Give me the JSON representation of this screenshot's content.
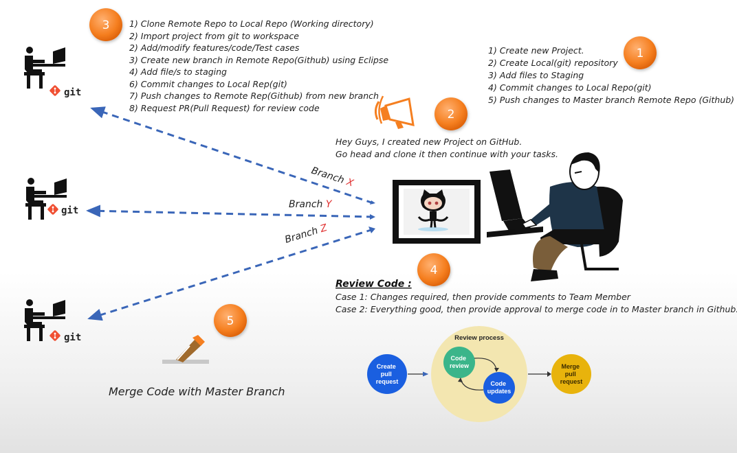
{
  "badges": [
    "1",
    "2",
    "3",
    "4",
    "5"
  ],
  "step3_list": [
    "1) Clone Remote Repo to Local Repo (Working directory)",
    "2) Import project from git to workspace",
    "2) Add/modify features/code/Test cases",
    "3) Create new branch in Remote Repo(Github) using Eclipse",
    "4) Add file/s to staging",
    "6) Commit changes to Local Rep(git)",
    "7) Push changes to Remote Rep(Github) from new branch",
    "8) Request PR(Pull Request) for review code"
  ],
  "step1_list": [
    "1) Create new Project.",
    "2) Create Local(git) repository",
    "3) Add files to Staging",
    "4) Commit changes to Local Repo(git)",
    "5) Push changes to Master branch Remote Repo (Github)"
  ],
  "announcement": [
    "Hey Guys, I created new Project on GitHub.",
    "Go head and clone it then continue with your tasks."
  ],
  "branches": [
    {
      "word": "Branch",
      "letter": "X"
    },
    {
      "word": "Branch",
      "letter": "Y"
    },
    {
      "word": "Branch",
      "letter": "Z"
    }
  ],
  "git_label": "git",
  "review": {
    "title": "Review Code :",
    "cases": [
      "Case 1: Changes required, then provide comments to Team Member",
      "Case 2: Everything good, then provide approval to merge code in to Master branch in Github."
    ]
  },
  "review_process": {
    "title": "Review process",
    "create": [
      "Create",
      "pull",
      "request"
    ],
    "code_review": [
      "Code",
      "review"
    ],
    "code_updates": [
      "Code",
      "updates"
    ],
    "merge": [
      "Merge",
      "pull",
      "request"
    ]
  },
  "merge_title": "Merge Code with Master Branch",
  "colors": {
    "badge": "#f57f20",
    "arrow": "#3a66b8",
    "branch_letter": "#e03030",
    "create_bubble": "#1a5fe0",
    "review_bubble": "#3bb58a",
    "updates_bubble": "#1a5fe0",
    "merge_bubble": "#e8b30c",
    "process_circle": "#f3e6b0"
  }
}
